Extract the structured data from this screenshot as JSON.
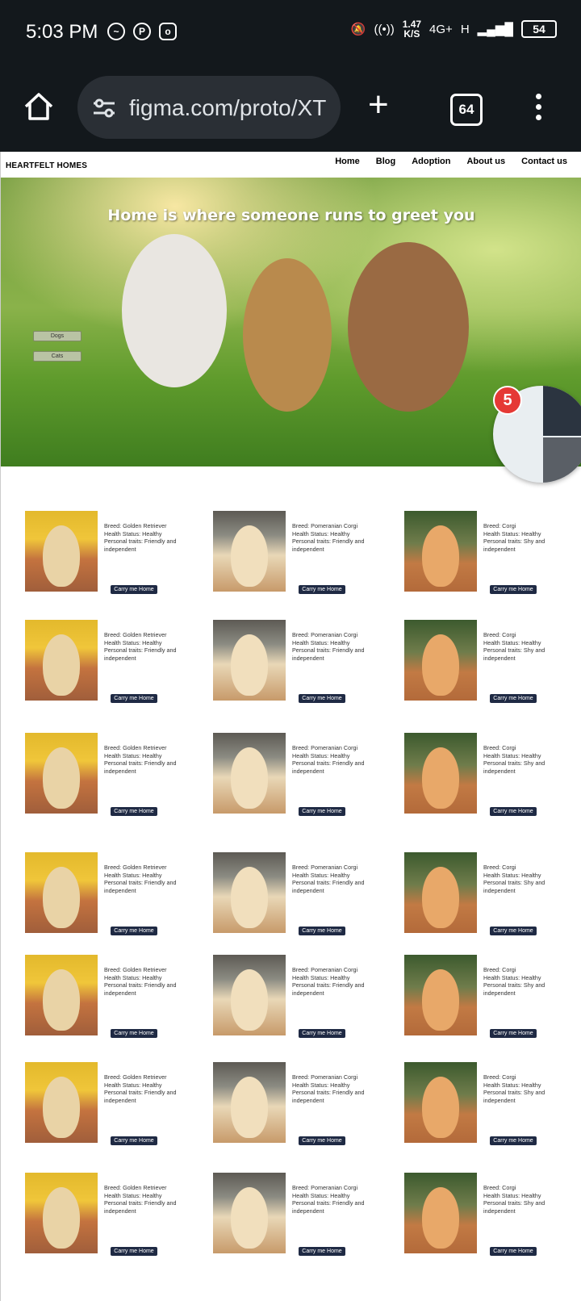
{
  "status_bar": {
    "time": "5:03 PM",
    "net_speed_value": "1.47",
    "net_speed_unit": "K/S",
    "network": "4G+",
    "network_h": "H",
    "battery": "54"
  },
  "browser": {
    "url": "figma.com/proto/XT",
    "tab_count": "64"
  },
  "site": {
    "brand": "HEARTFELT HOMES",
    "nav": [
      "Home",
      "Blog",
      "Adoption",
      "About us",
      "Contact us"
    ]
  },
  "hero": {
    "title": "Home is where  someone runs to greet you",
    "filter_dogs": "Dogs",
    "filter_cats": "Cats"
  },
  "chat_head": {
    "badge_count": "5"
  },
  "pets": {
    "golden": {
      "breed": "Breed: Golden Retriever",
      "health": "Health Status: Healthy",
      "traits": "Personal traits: Friendly and independent"
    },
    "pom": {
      "breed": "Breed: Pomeranian Corgi",
      "health": "Health Status: Healthy",
      "traits": "Personal traits: Friendly and independent"
    },
    "corgi": {
      "breed": "Breed: Corgi",
      "health": "Health Status: Healthy",
      "traits": "Personal traits: Shy and independent"
    },
    "cta": "Carry me Home"
  }
}
